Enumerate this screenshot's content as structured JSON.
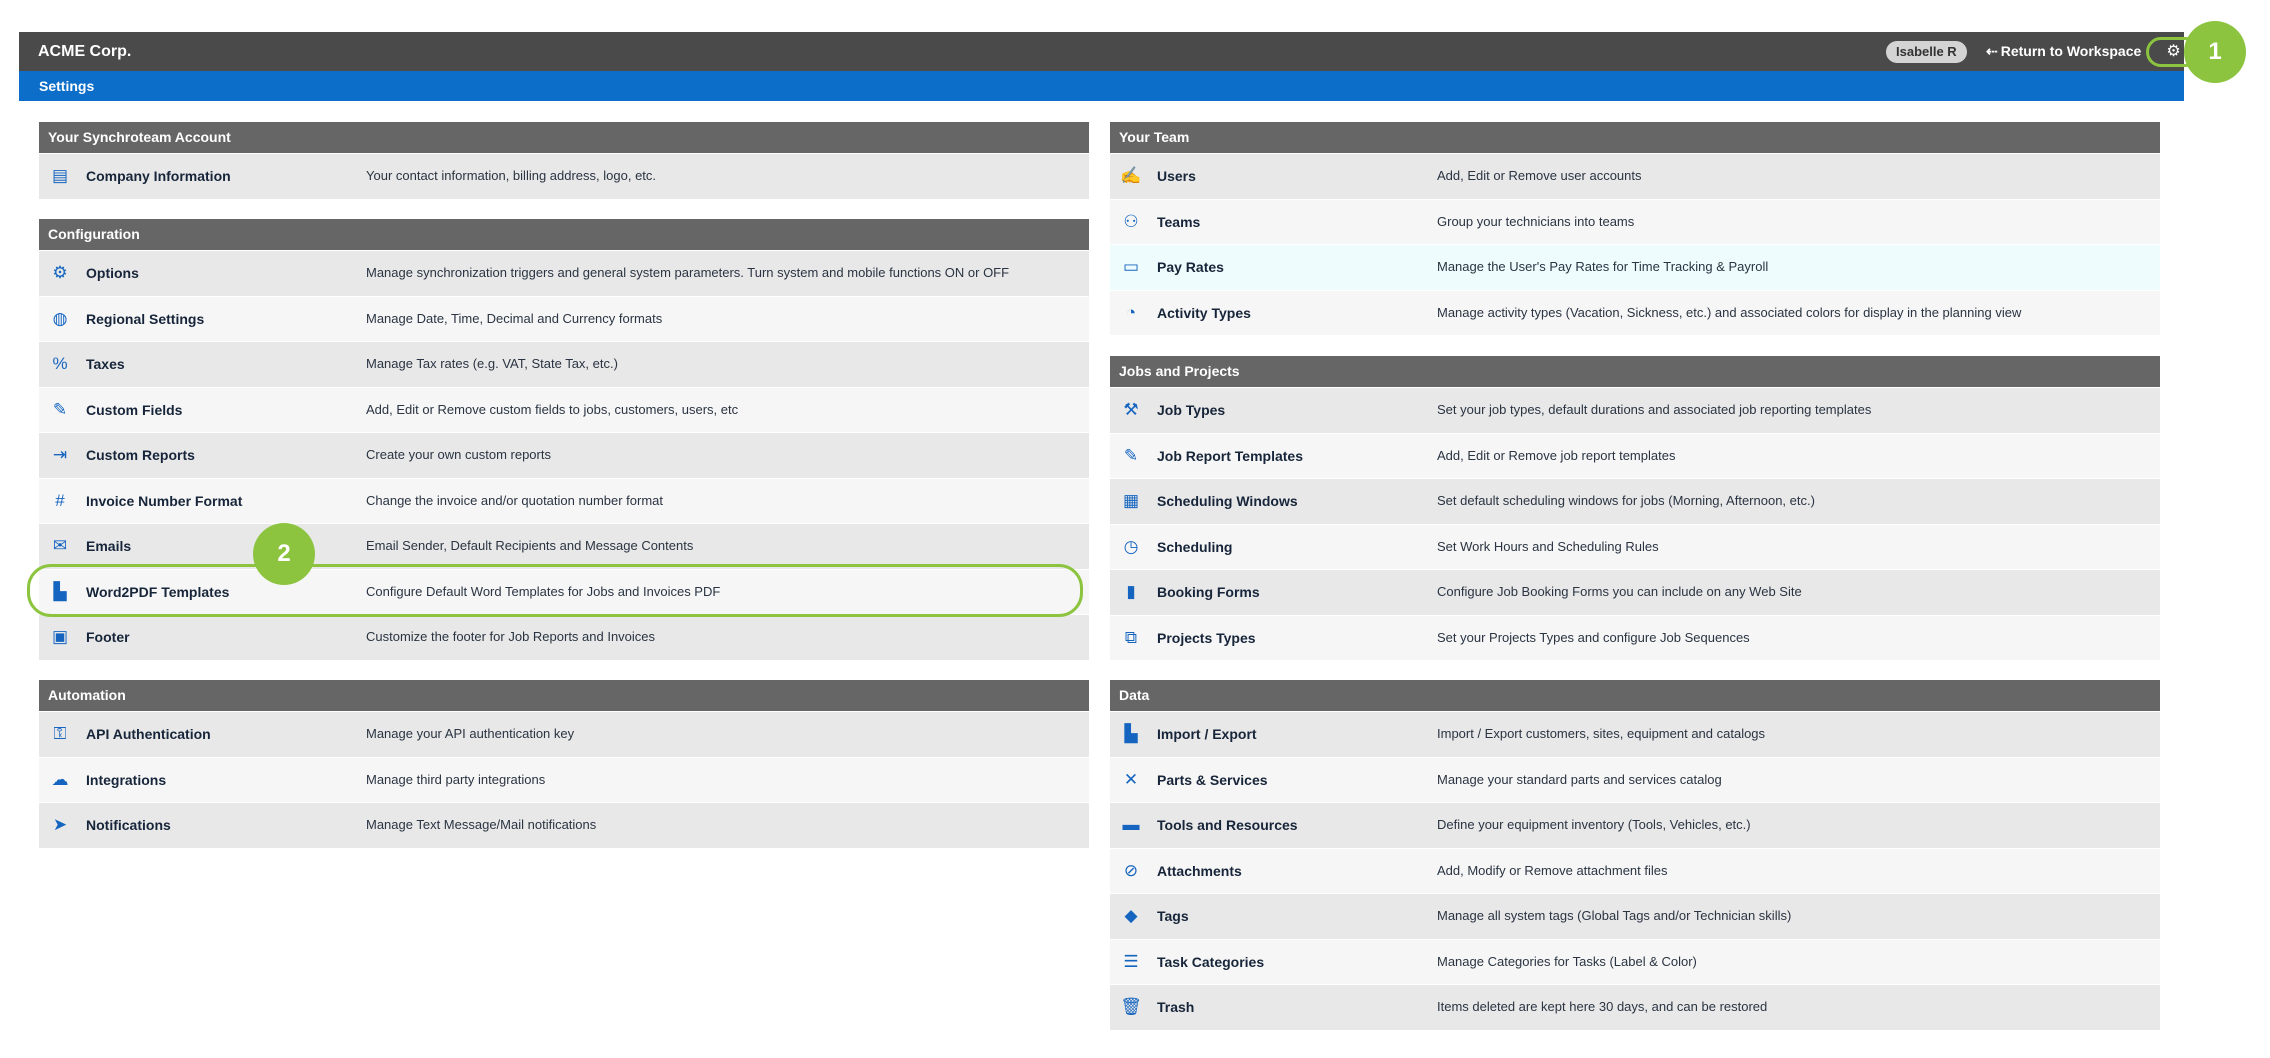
{
  "header": {
    "brand": "ACME Corp.",
    "user": "Isabelle R",
    "return_label": "Return to Workspace",
    "return_arrow": "⇠",
    "settings_icon": "gear-icon"
  },
  "subheader": {
    "title": "Settings"
  },
  "callouts": {
    "one": "1",
    "two": "2"
  },
  "left_sections": [
    {
      "title": "Your Synchroteam Account",
      "rows": [
        {
          "icon": "id-card-icon",
          "glyph": "▤",
          "name": "Company Information",
          "desc": "Your contact information, billing address, logo, etc."
        }
      ]
    },
    {
      "title": "Configuration",
      "rows": [
        {
          "icon": "gear-icon",
          "glyph": "⚙",
          "name": "Options",
          "desc": "Manage synchronization triggers and general system parameters. Turn system and mobile functions ON or OFF"
        },
        {
          "icon": "globe-icon",
          "glyph": "◍",
          "name": "Regional Settings",
          "desc": "Manage Date, Time, Decimal and Currency formats"
        },
        {
          "icon": "percent-icon",
          "glyph": "%",
          "name": "Taxes",
          "desc": "Manage Tax rates (e.g. VAT, State Tax, etc.)"
        },
        {
          "icon": "edit-icon",
          "glyph": "✎",
          "name": "Custom Fields",
          "desc": "Add, Edit or Remove custom fields to jobs, customers, users, etc"
        },
        {
          "icon": "file-export-icon",
          "glyph": "⇥",
          "name": "Custom Reports",
          "desc": "Create your own custom reports"
        },
        {
          "icon": "hashtag-icon",
          "glyph": "#",
          "name": "Invoice Number Format",
          "desc": "Change the invoice and/or quotation number format"
        },
        {
          "icon": "envelope-icon",
          "glyph": "✉",
          "name": "Emails",
          "desc": "Email Sender, Default Recipients and Message Contents"
        },
        {
          "icon": "pdf-file-icon",
          "glyph": "▙",
          "name": "Word2PDF Templates",
          "desc": "Configure Default Word Templates for Jobs and Invoices PDF"
        },
        {
          "icon": "footer-icon",
          "glyph": "▣",
          "name": "Footer",
          "desc": "Customize the footer for Job Reports and Invoices"
        }
      ]
    },
    {
      "title": "Automation",
      "rows": [
        {
          "icon": "key-icon",
          "glyph": "⚿",
          "name": "API Authentication",
          "desc": "Manage your API authentication key"
        },
        {
          "icon": "cloud-icon",
          "glyph": "☁",
          "name": "Integrations",
          "desc": "Manage third party integrations"
        },
        {
          "icon": "paper-plane-icon",
          "glyph": "➤",
          "name": "Notifications",
          "desc": "Manage Text Message/Mail notifications"
        }
      ]
    }
  ],
  "right_sections": [
    {
      "title": "Your Team",
      "rows": [
        {
          "icon": "user-edit-icon",
          "glyph": "✍",
          "name": "Users",
          "desc": "Add, Edit or Remove user accounts"
        },
        {
          "icon": "people-group-icon",
          "glyph": "⚇",
          "name": "Teams",
          "desc": "Group your technicians into teams"
        },
        {
          "icon": "money-bill-icon",
          "glyph": "▭",
          "name": "Pay Rates",
          "desc": "Manage the User's Pay Rates for Time Tracking & Payroll"
        },
        {
          "icon": "user-clock-icon",
          "glyph": "◔",
          "name": "Activity Types",
          "desc": "Manage activity types (Vacation, Sickness, etc.) and associated colors for display in the planning view"
        }
      ]
    },
    {
      "title": "Jobs and Projects",
      "rows": [
        {
          "icon": "wrench-icon",
          "glyph": "⚒",
          "name": "Job Types",
          "desc": "Set your job types, default durations and associated job reporting templates"
        },
        {
          "icon": "file-signature-icon",
          "glyph": "✎",
          "name": "Job Report Templates",
          "desc": "Add, Edit or Remove job report templates"
        },
        {
          "icon": "calendar-check-icon",
          "glyph": "▦",
          "name": "Scheduling Windows",
          "desc": "Set default scheduling windows for jobs (Morning, Afternoon, etc.)"
        },
        {
          "icon": "clock-icon",
          "glyph": "◷",
          "name": "Scheduling",
          "desc": "Set Work Hours and Scheduling Rules"
        },
        {
          "icon": "clipboard-icon",
          "glyph": "▮",
          "name": "Booking Forms",
          "desc": "Configure Job Booking Forms you can include on any Web Site"
        },
        {
          "icon": "diagram-project-icon",
          "glyph": "⧉",
          "name": "Projects Types",
          "desc": "Set your Projects Types and configure Job Sequences"
        }
      ]
    },
    {
      "title": "Data",
      "rows": [
        {
          "icon": "csv-file-icon",
          "glyph": "▙",
          "name": "Import / Export",
          "desc": "Import / Export customers, sites, equipment and catalogs"
        },
        {
          "icon": "tools-icon",
          "glyph": "✕",
          "name": "Parts & Services",
          "desc": "Manage your standard parts and services catalog"
        },
        {
          "icon": "toolbox-icon",
          "glyph": "▬",
          "name": "Tools and Resources",
          "desc": "Define your equipment inventory (Tools, Vehicles, etc.)"
        },
        {
          "icon": "paperclip-icon",
          "glyph": "⊘",
          "name": "Attachments",
          "desc": "Add, Modify or Remove attachment files"
        },
        {
          "icon": "tags-icon",
          "glyph": "◆",
          "name": "Tags",
          "desc": "Manage all system tags (Global Tags and/or Technician skills)"
        },
        {
          "icon": "list-icon",
          "glyph": "☰",
          "name": "Task Categories",
          "desc": "Manage Categories for Tasks (Label & Color)"
        },
        {
          "icon": "trash-icon",
          "glyph": "🗑",
          "name": "Trash",
          "desc": "Items deleted are kept here 30 days, and can be restored"
        }
      ]
    }
  ]
}
